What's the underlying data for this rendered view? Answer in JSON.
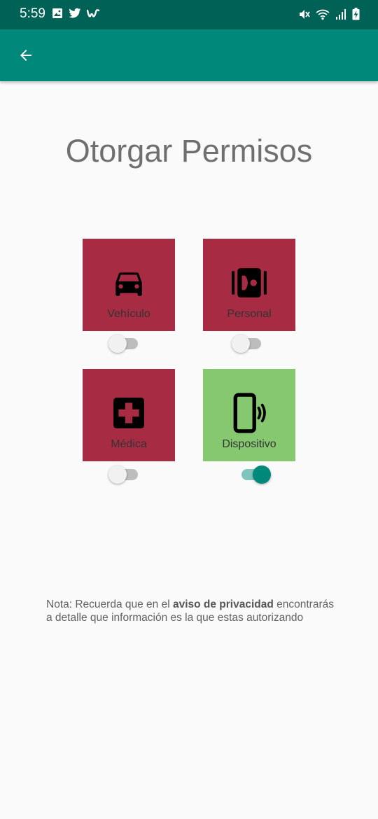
{
  "status_bar": {
    "time": "5:59",
    "left_icons": [
      "gallery-icon",
      "twitter-icon",
      "w-app-icon"
    ],
    "right_icons": [
      "mute-icon",
      "wifi-icon",
      "signal-icon",
      "battery-icon"
    ]
  },
  "app_bar": {
    "back_icon": "arrow-left-icon",
    "color": "#00897b"
  },
  "page": {
    "title": "Otorgar Permisos"
  },
  "permissions": [
    {
      "id": "vehiculo",
      "label": "Vehículo",
      "icon": "car-icon",
      "color": "#a72c43",
      "enabled": false
    },
    {
      "id": "personal",
      "label": "Personal",
      "icon": "contact-icon",
      "color": "#a72c43",
      "enabled": false
    },
    {
      "id": "medica",
      "label": "Médica",
      "icon": "medical-cross-icon",
      "color": "#a72c43",
      "enabled": false
    },
    {
      "id": "dispositivo",
      "label": "Dispositivo",
      "icon": "phone-vibrate-icon",
      "color": "#86c86f",
      "enabled": true
    }
  ],
  "note": {
    "prefix": "Nota: Recuerda que en el ",
    "bold": "aviso de privacidad",
    "suffix": " encontrarás a detalle que información es la que estas autorizando"
  }
}
